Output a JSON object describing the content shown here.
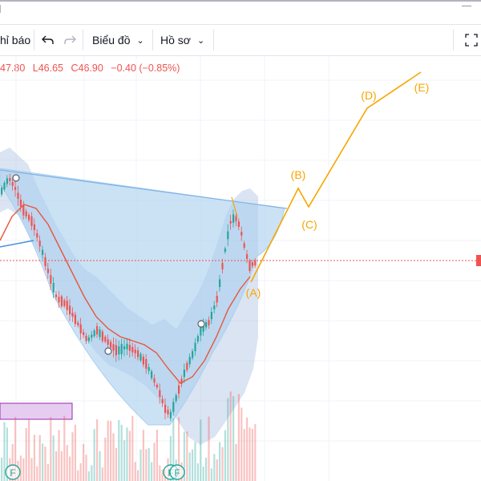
{
  "toolbar": {
    "alerts_label": "hỉ báo",
    "undo_icon": "undo-icon",
    "redo_icon": "redo-icon",
    "chart_menu_label": "Biểu đồ",
    "profile_menu_label": "Hồ sơ",
    "fullscreen_icon": "fullscreen-icon"
  },
  "ohlc": {
    "high": "47.80",
    "low_prefix": "L",
    "low": "46.65",
    "close_prefix": "C",
    "close": "46.90",
    "change": "−0.40 (−0.85%)"
  },
  "wave_labels": [
    "(A)",
    "(B)",
    "(C)",
    "(D)",
    "(E)"
  ],
  "event_markers": [
    "F",
    "F",
    "F"
  ],
  "colors": {
    "up": "#26a69a",
    "down": "#ef5350",
    "wave": "#f7a600",
    "ma": "#e8563a",
    "band_fill": "#7f9fcf",
    "cup_fill": "#a9cfee",
    "price_line": "#ef5350",
    "pattern_box": "#e6ccf0"
  }
}
